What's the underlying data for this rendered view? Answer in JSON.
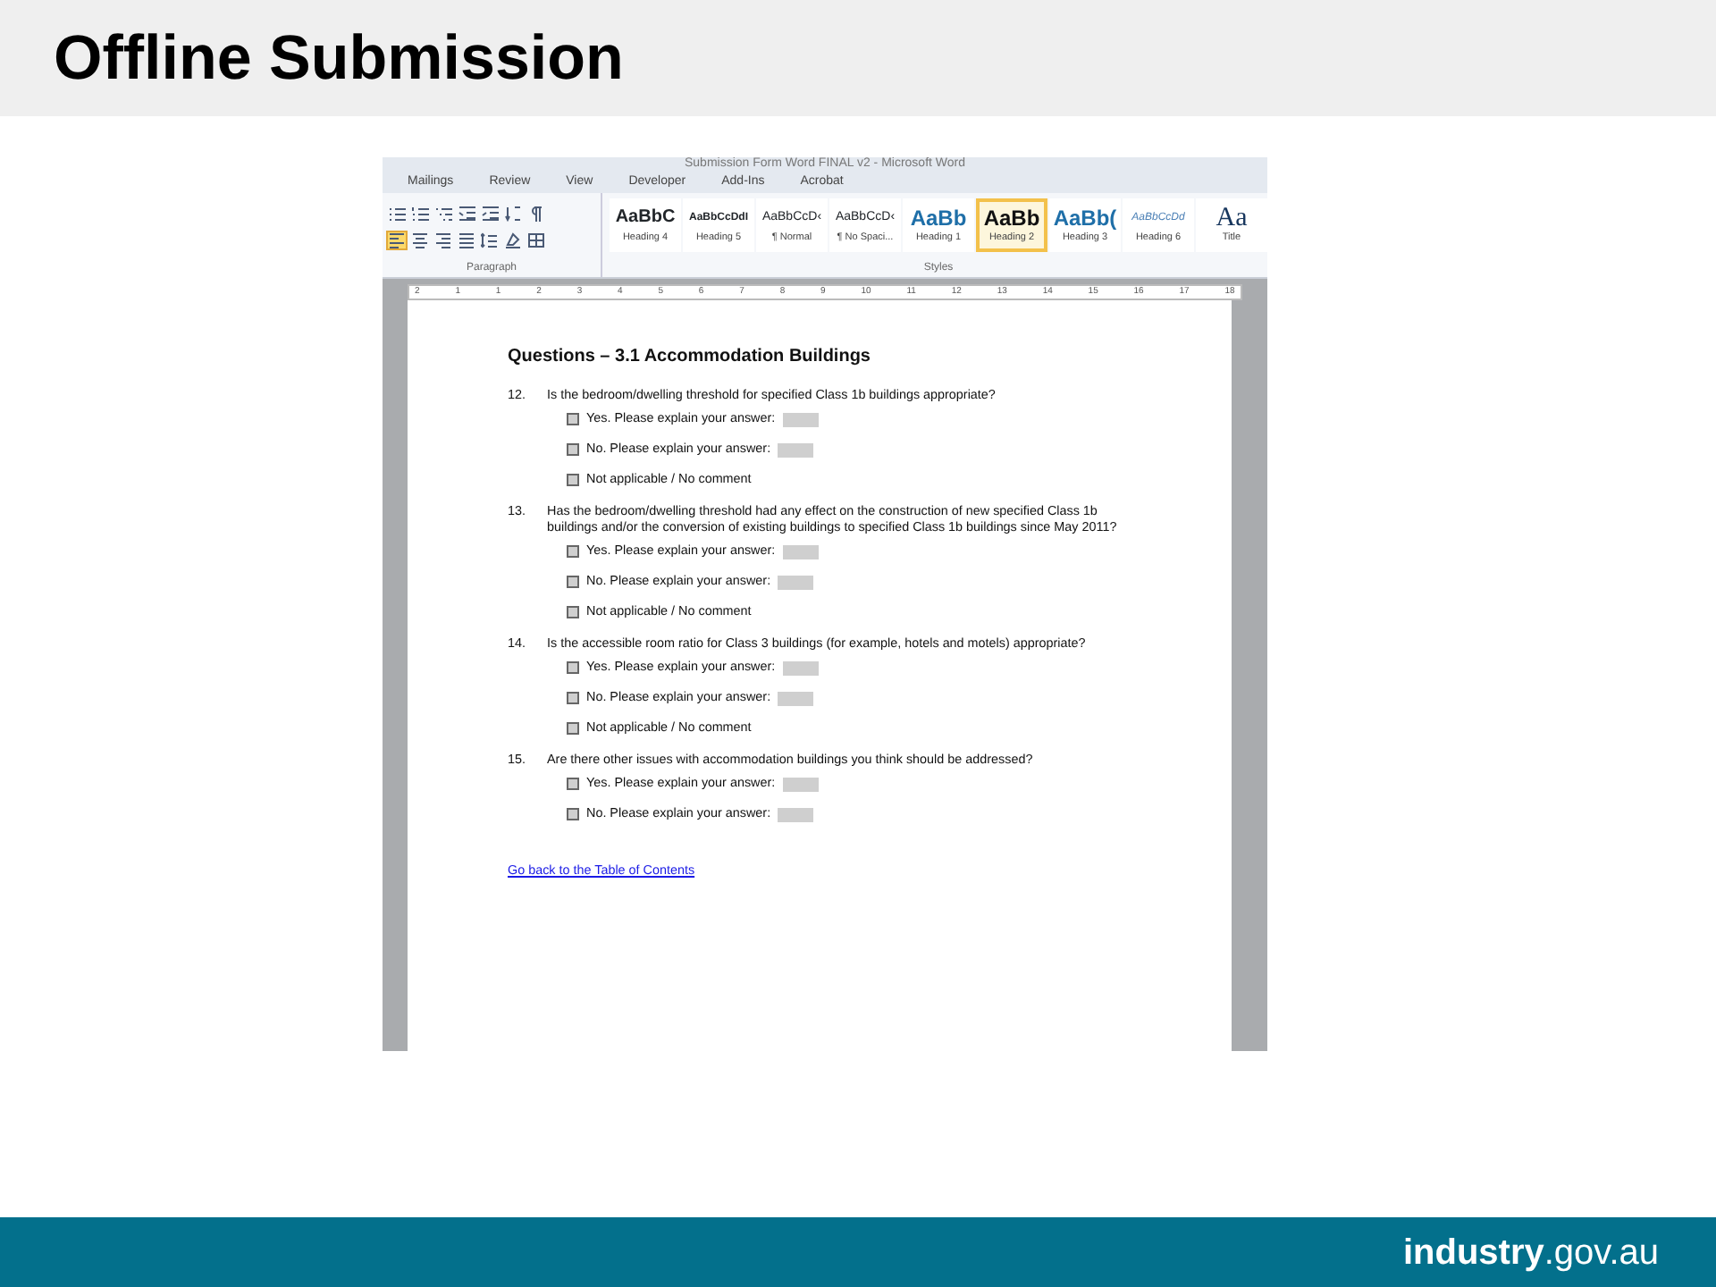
{
  "slide": {
    "title": "Offline Submission"
  },
  "window": {
    "title": "Submission Form Word FINAL v2 - Microsoft Word"
  },
  "ribbon_tabs": [
    {
      "label": "Mailings",
      "selected": false
    },
    {
      "label": "Review",
      "selected": false
    },
    {
      "label": "View",
      "selected": false
    },
    {
      "label": "Developer",
      "selected": false
    },
    {
      "label": "Add-Ins",
      "selected": false
    },
    {
      "label": "Acrobat",
      "selected": false
    }
  ],
  "paragraph_group": {
    "label": "Paragraph",
    "alignment": [
      {
        "kind": "left",
        "selected": true
      },
      {
        "kind": "center",
        "selected": false
      },
      {
        "kind": "right",
        "selected": false
      },
      {
        "kind": "justify",
        "selected": false
      }
    ]
  },
  "styles_group": {
    "label": "Styles",
    "styles": [
      {
        "preview": "AaBbC",
        "name": "Heading 4",
        "kind": "bold",
        "selected": false
      },
      {
        "preview": "AaBbCcDdI",
        "name": "Heading 5",
        "kind": "small-bold",
        "selected": false
      },
      {
        "preview": "AaBbCcD‹",
        "name": "¶ Normal",
        "kind": "plain",
        "selected": false
      },
      {
        "preview": "AaBbCcD‹",
        "name": "¶ No Spaci...",
        "kind": "plain",
        "selected": false
      },
      {
        "preview": "AaBb",
        "name": "Heading 1",
        "kind": "heading-blue",
        "selected": false
      },
      {
        "preview": "AaBb",
        "name": "Heading 2",
        "kind": "heading-dark",
        "selected": true
      },
      {
        "preview": "AaBb(",
        "name": "Heading 3",
        "kind": "heading-blue",
        "selected": false
      },
      {
        "preview": "AaBbCcDd",
        "name": "Heading 6",
        "kind": "italic",
        "selected": false
      },
      {
        "preview": "Aa",
        "name": "Title",
        "kind": "title",
        "selected": false
      }
    ]
  },
  "ruler": [
    "2",
    "1",
    "1",
    "2",
    "3",
    "4",
    "5",
    "6",
    "7",
    "8",
    "9",
    "10",
    "11",
    "12",
    "13",
    "14",
    "15",
    "16",
    "17",
    "18"
  ],
  "document": {
    "heading": "Questions – 3.1 Accommodation Buildings",
    "questions": [
      {
        "number": "12.",
        "text": "Is the bedroom/dwelling threshold for specified Class 1b buildings appropriate?",
        "options": [
          {
            "kind": "explain",
            "label": "Yes. Please explain your answer:",
            "checked": false
          },
          {
            "kind": "explain",
            "label": "No. Please explain your answer:",
            "checked": false
          },
          {
            "kind": "plain",
            "label": "Not applicable / No comment",
            "checked": false
          }
        ]
      },
      {
        "number": "13.",
        "text": "Has the bedroom/dwelling threshold had any effect on the construction of new specified Class 1b buildings and/or the conversion of existing buildings to specified Class 1b buildings since May 2011?",
        "options": [
          {
            "kind": "explain",
            "label": "Yes. Please explain your answer:",
            "checked": false
          },
          {
            "kind": "explain",
            "label": "No. Please explain your answer:",
            "checked": false
          },
          {
            "kind": "plain",
            "label": "Not applicable / No comment",
            "checked": false
          }
        ]
      },
      {
        "number": "14.",
        "text": "Is the accessible room ratio for Class 3 buildings (for example, hotels and motels) appropriate?",
        "options": [
          {
            "kind": "explain",
            "label": "Yes. Please explain your answer:",
            "checked": false
          },
          {
            "kind": "explain",
            "label": "No. Please explain your answer:",
            "checked": false
          },
          {
            "kind": "plain",
            "label": "Not applicable / No comment",
            "checked": false
          }
        ]
      },
      {
        "number": "15.",
        "text": "Are there other issues with accommodation buildings you think should be addressed?",
        "options": [
          {
            "kind": "explain",
            "label": "Yes. Please explain your answer:",
            "checked": false
          },
          {
            "kind": "explain",
            "label": "No. Please explain your answer:",
            "checked": false
          }
        ]
      }
    ],
    "link": "Go back to the Table of Contents"
  },
  "footer": {
    "logo": "**industry**.gov.au"
  }
}
